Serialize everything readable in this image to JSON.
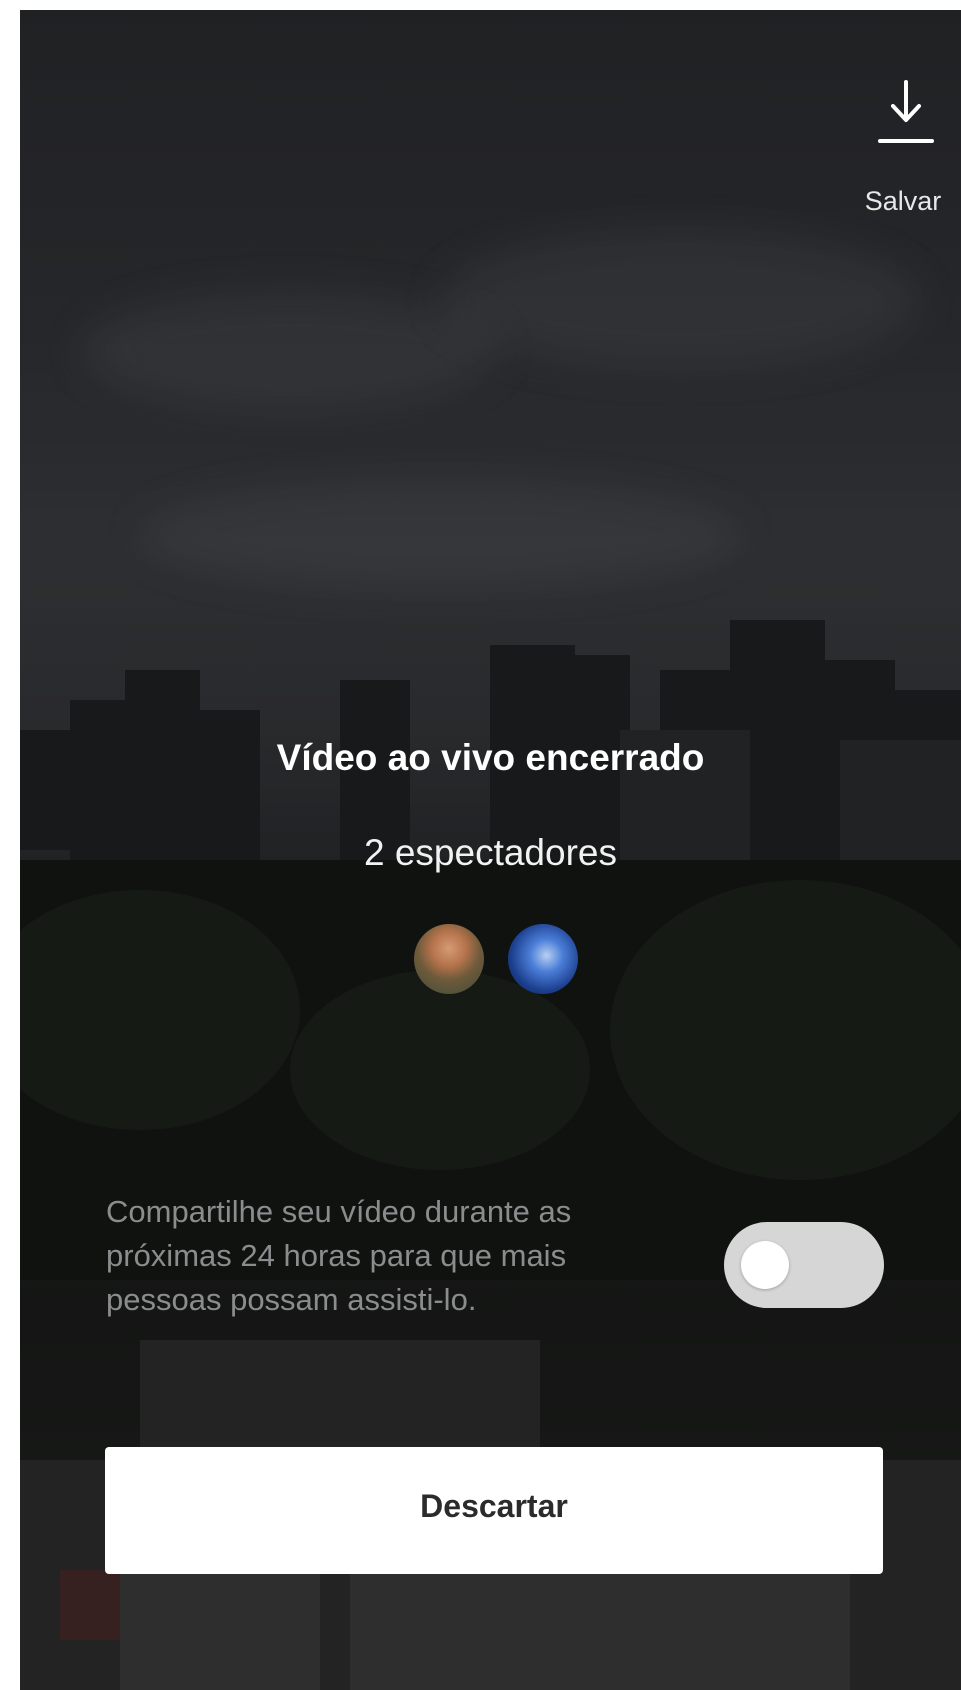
{
  "header": {
    "save_label": "Salvar",
    "save_icon": "download-icon"
  },
  "summary": {
    "title": "Vídeo ao vivo encerrado",
    "viewers": "2 espectadores"
  },
  "share": {
    "text": "Compartilhe seu vídeo durante as próximas 24 horas para que mais pessoas possam assisti-lo.",
    "toggle_on": false
  },
  "actions": {
    "discard_label": "Descartar"
  },
  "colors": {
    "overlay": "#2a2b2e",
    "toggle_track": "#d6d6d6",
    "button_bg": "#ffffff"
  }
}
